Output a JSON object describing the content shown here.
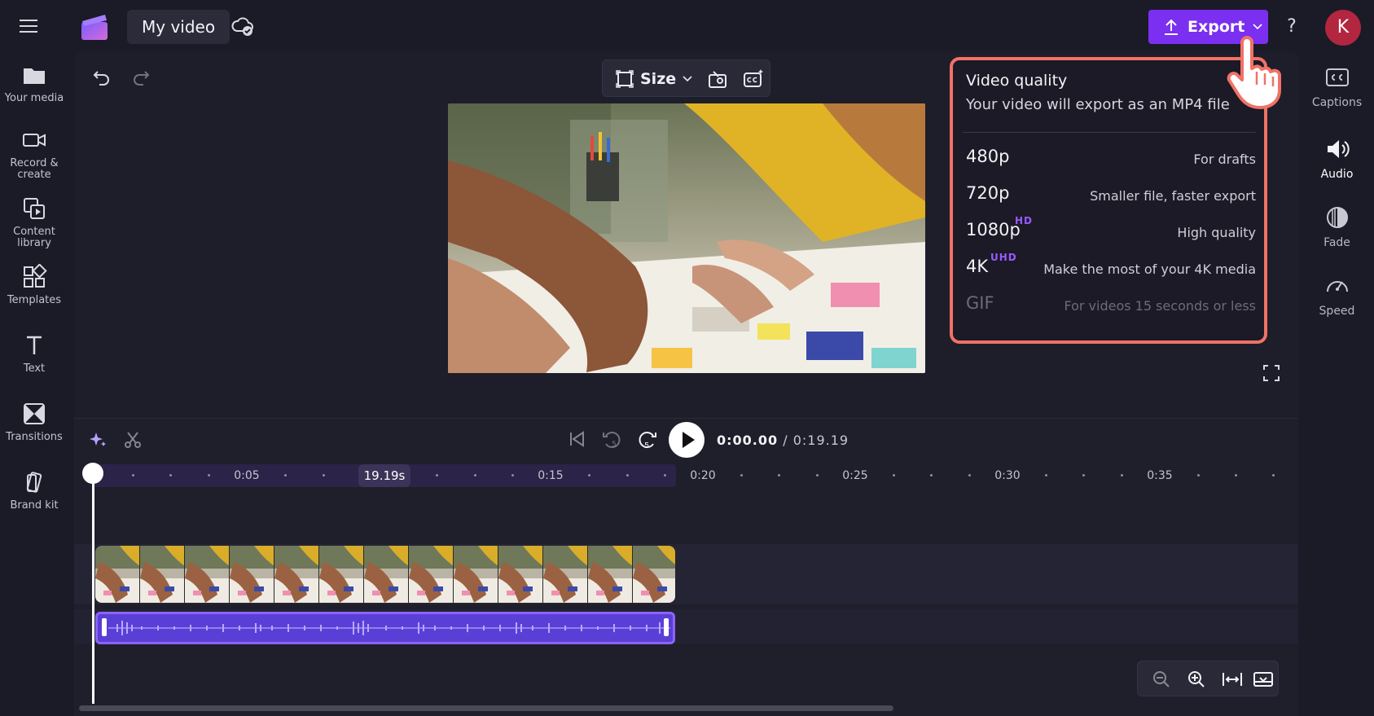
{
  "topbar": {
    "project_title": "My video",
    "export_label": "Export",
    "help_label": "?",
    "avatar_initial": "K"
  },
  "left_sidebar": {
    "items": [
      {
        "label": "Your media"
      },
      {
        "label": "Record &\ncreate"
      },
      {
        "label": "Content\nlibrary"
      },
      {
        "label": "Templates"
      },
      {
        "label": "Text"
      },
      {
        "label": "Transitions"
      },
      {
        "label": "Brand kit"
      }
    ]
  },
  "right_sidebar": {
    "items": [
      {
        "label": "Captions"
      },
      {
        "label": "Audio"
      },
      {
        "label": "Fade"
      },
      {
        "label": "Speed"
      }
    ]
  },
  "preview_toolbar": {
    "size_label": "Size"
  },
  "quality_popover": {
    "title": "Video quality",
    "subtitle": "Your video will export as an MP4 file",
    "options": [
      {
        "resolution": "480p",
        "badge": "",
        "description": "For drafts",
        "enabled": true
      },
      {
        "resolution": "720p",
        "badge": "",
        "description": "Smaller file, faster export",
        "enabled": true
      },
      {
        "resolution": "1080p",
        "badge": "HD",
        "description": "High quality",
        "enabled": true
      },
      {
        "resolution": "4K",
        "badge": "UHD",
        "description": "Make the most of your 4K media",
        "enabled": true
      },
      {
        "resolution": "GIF",
        "badge": "",
        "description": "For videos 15 seconds or less",
        "enabled": false
      }
    ]
  },
  "playback": {
    "current_time": "0:00.00",
    "separator": "/",
    "total_time": "0:19.19",
    "forward_seconds": "5",
    "rewind_seconds": "5"
  },
  "timeline": {
    "duration_chip": "19.19s",
    "ticks": [
      "0:05",
      "0:15",
      "0:20",
      "0:25",
      "0:30",
      "0:35"
    ]
  },
  "colors": {
    "accent": "#7b2ff0",
    "popover_outline": "#f07266",
    "badge": "#9a59ff",
    "avatar": "#b3263f",
    "audio_clip": "#5a3fd6"
  }
}
